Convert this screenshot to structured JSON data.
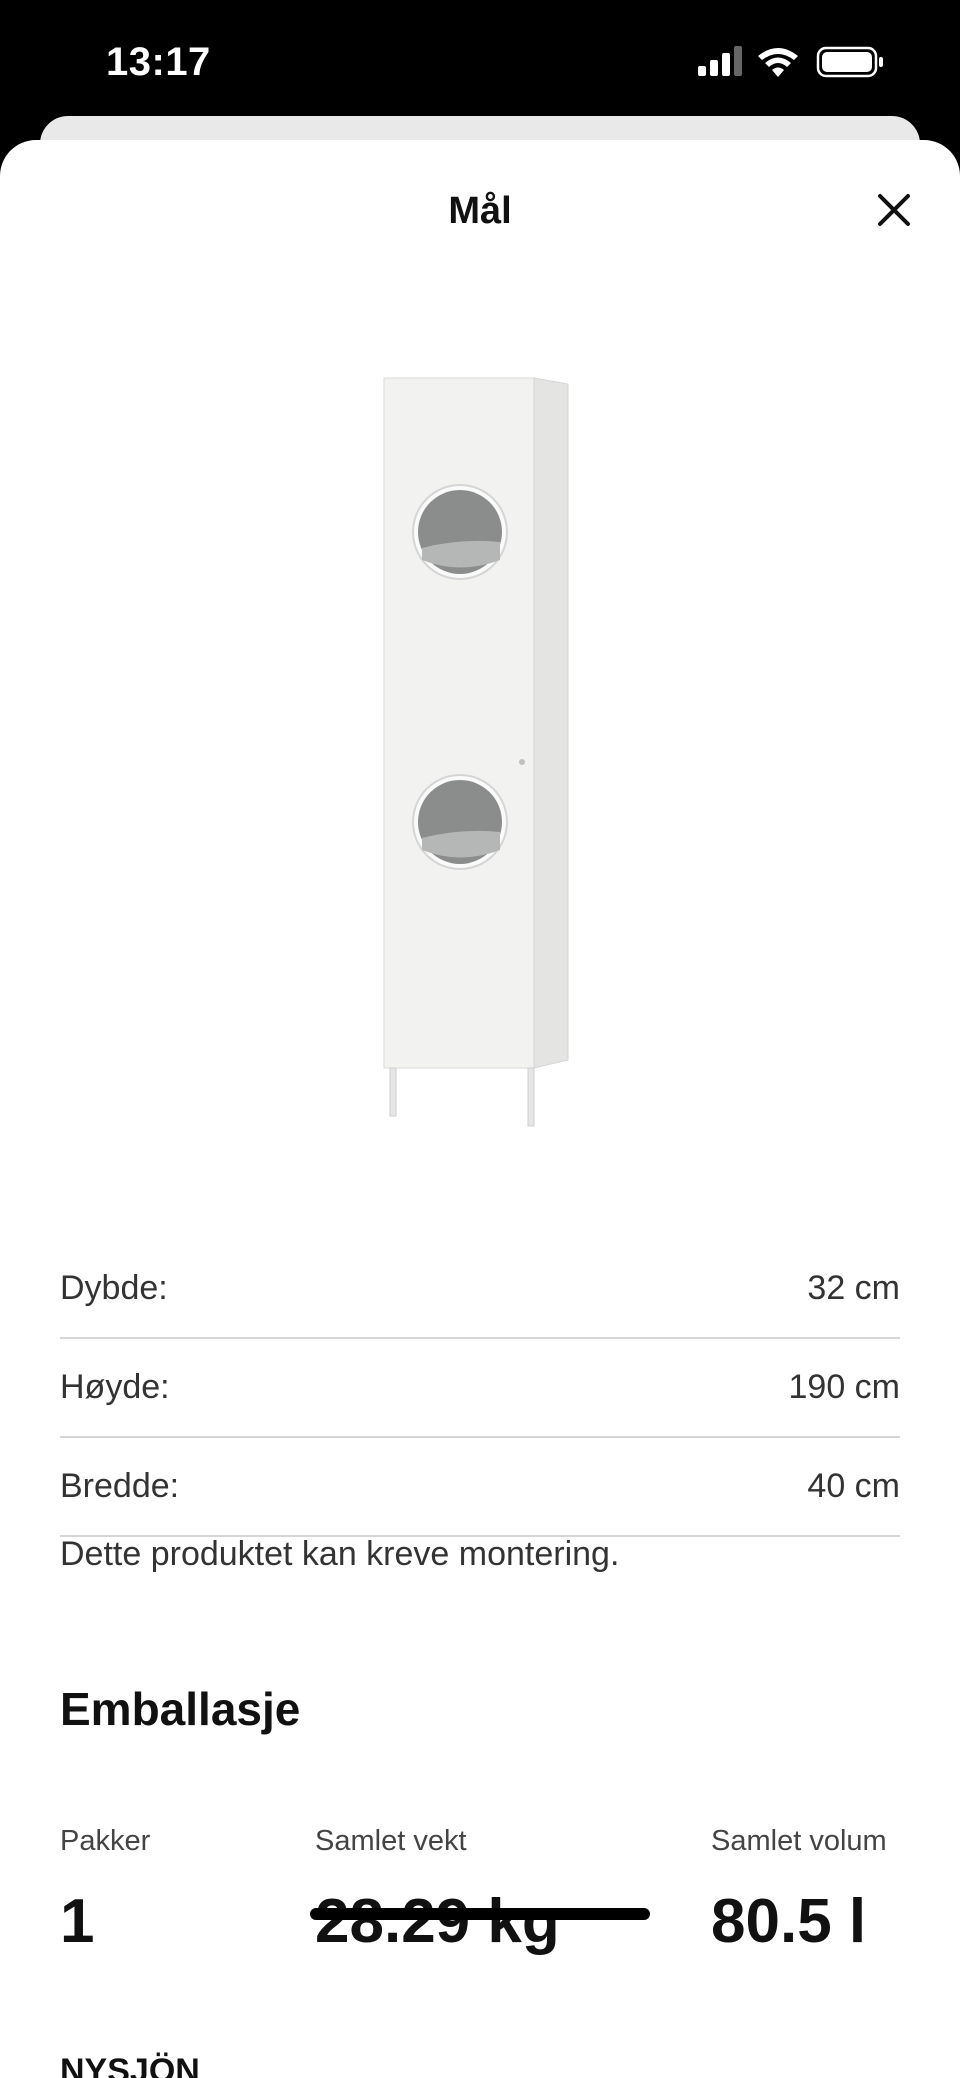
{
  "status_bar": {
    "time": "13:17"
  },
  "sheet": {
    "title": "Mål"
  },
  "dimensions": [
    {
      "label": "Dybde:",
      "value": "32 cm"
    },
    {
      "label": "Høyde:",
      "value": "190 cm"
    },
    {
      "label": "Bredde:",
      "value": "40 cm"
    }
  ],
  "assembly_note": "Dette produktet kan kreve montering.",
  "packaging": {
    "title": "Emballasje",
    "packages_label": "Pakker",
    "packages_value": "1",
    "weight_label": "Samlet vekt",
    "weight_value": "28.29 kg",
    "volume_label": "Samlet volum",
    "volume_value": "80.5 l"
  },
  "next_section_title": "NYSJÖN"
}
